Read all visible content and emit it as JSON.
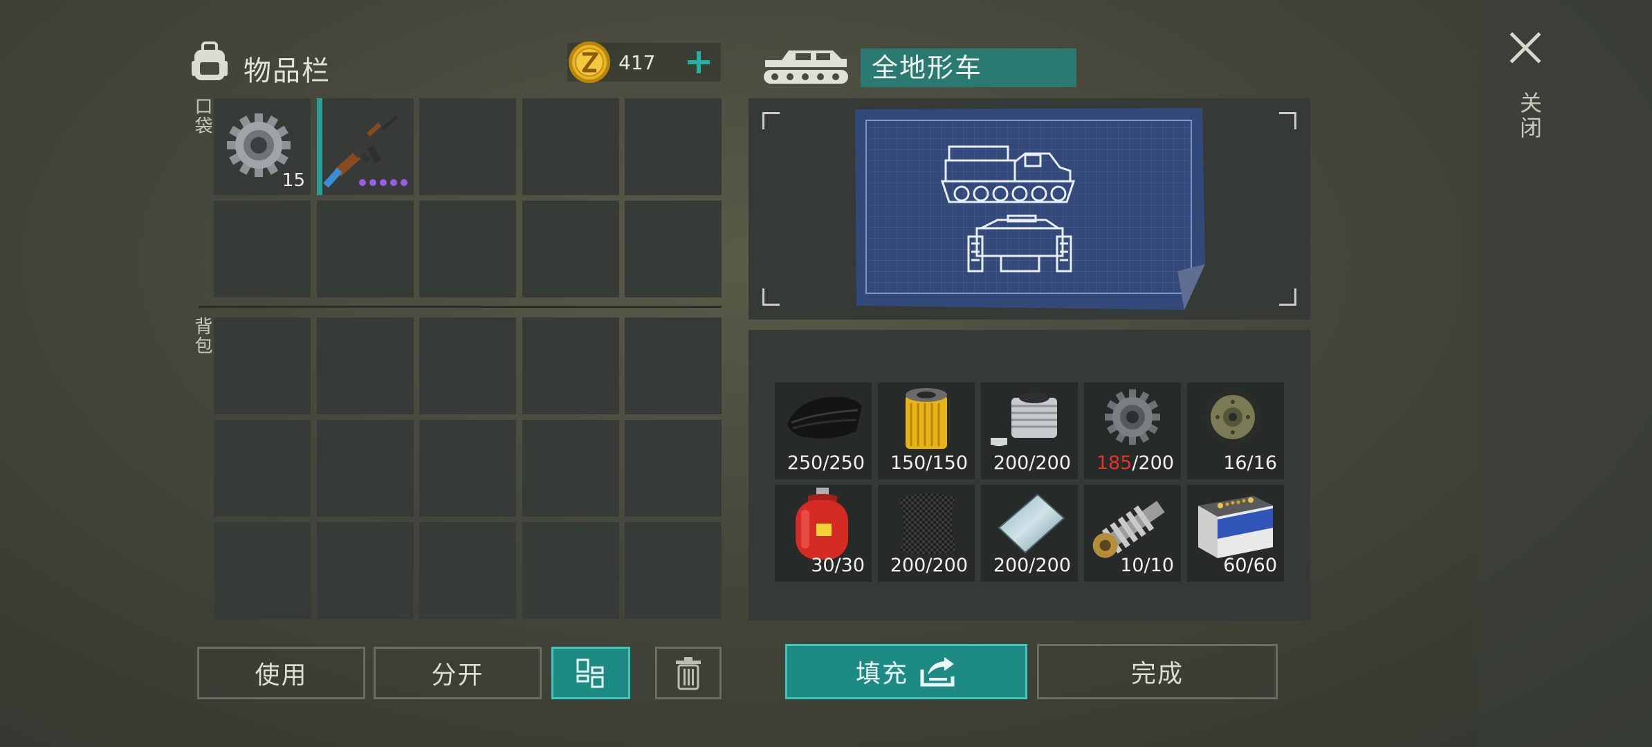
{
  "inventory": {
    "title": "物品栏",
    "currency": {
      "amount": "417",
      "icon": "zcoin-icon"
    },
    "pockets_label": "口袋",
    "backpack_label": "背包",
    "pocket_slots": [
      {
        "item": "gear-icon",
        "count": "15"
      },
      {
        "item": "assault-rifle-icon",
        "durability_dots": 5,
        "dot_color": "#9b5de5"
      }
    ]
  },
  "buttons": {
    "use": "使用",
    "split": "分开",
    "fill": "填充",
    "complete": "完成"
  },
  "vehicle": {
    "name": "全地形车",
    "requirements": [
      {
        "item": "rubber-icon",
        "have": "250",
        "need": "/250"
      },
      {
        "item": "oil-filter-icon",
        "have": "150",
        "need": "/150"
      },
      {
        "item": "engine-cylinder-icon",
        "have": "200",
        "need": "/200"
      },
      {
        "item": "gear-icon",
        "have": "185",
        "need": "/200",
        "short": true
      },
      {
        "item": "road-wheel-icon",
        "have": "16",
        "need": "/16"
      },
      {
        "item": "gas-cylinder-icon",
        "have": "30",
        "need": "/30"
      },
      {
        "item": "carbon-sheet-icon",
        "have": "200",
        "need": "/200"
      },
      {
        "item": "metal-plate-icon",
        "have": "200",
        "need": "/200"
      },
      {
        "item": "drive-shaft-icon",
        "have": "10",
        "need": "/10"
      },
      {
        "item": "car-battery-icon",
        "have": "60",
        "need": "/60"
      }
    ]
  },
  "close_label": "关闭",
  "colors": {
    "accent": "#1d8b84",
    "short": "#e2342c",
    "slot": "#363b38"
  }
}
